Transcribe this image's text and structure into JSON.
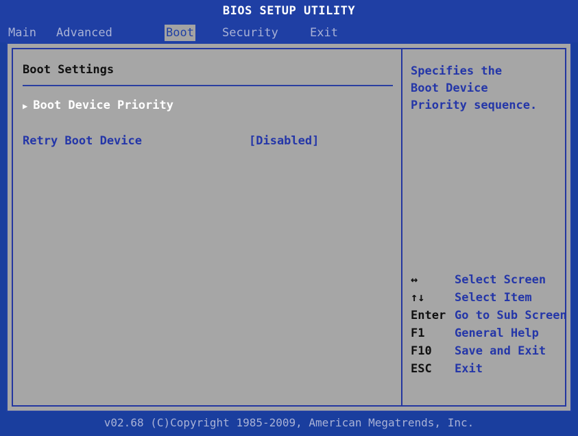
{
  "app": {
    "title": "BIOS SETUP UTILITY"
  },
  "menu": [
    {
      "label": "Main",
      "active": false
    },
    {
      "label": "Advanced",
      "active": false
    },
    {
      "label": "Boot",
      "active": true
    },
    {
      "label": "Security",
      "active": false
    },
    {
      "label": "Exit",
      "active": false
    }
  ],
  "main": {
    "section_title": "Boot Settings",
    "submenu_item": "Boot Device Priority",
    "setting": {
      "label": "Retry Boot Device",
      "value": "[Disabled]"
    }
  },
  "help": {
    "line1": "Specifies the",
    "line2": "Boot Device",
    "line3": "Priority sequence."
  },
  "keys": [
    {
      "key": "↔",
      "desc": "Select Screen"
    },
    {
      "key": "↑↓",
      "desc": "Select Item"
    },
    {
      "key": "Enter",
      "desc": "Go to Sub Screen"
    },
    {
      "key": "F1",
      "desc": "General Help"
    },
    {
      "key": "F10",
      "desc": "Save and Exit"
    },
    {
      "key": "ESC",
      "desc": "Exit"
    }
  ],
  "footer": {
    "text": "v02.68 (C)Copyright 1985-2009, American Megatrends, Inc."
  },
  "colors": {
    "background": "#1f3fa4",
    "panel": "#a6a6a6",
    "accent": "#2436a8"
  }
}
